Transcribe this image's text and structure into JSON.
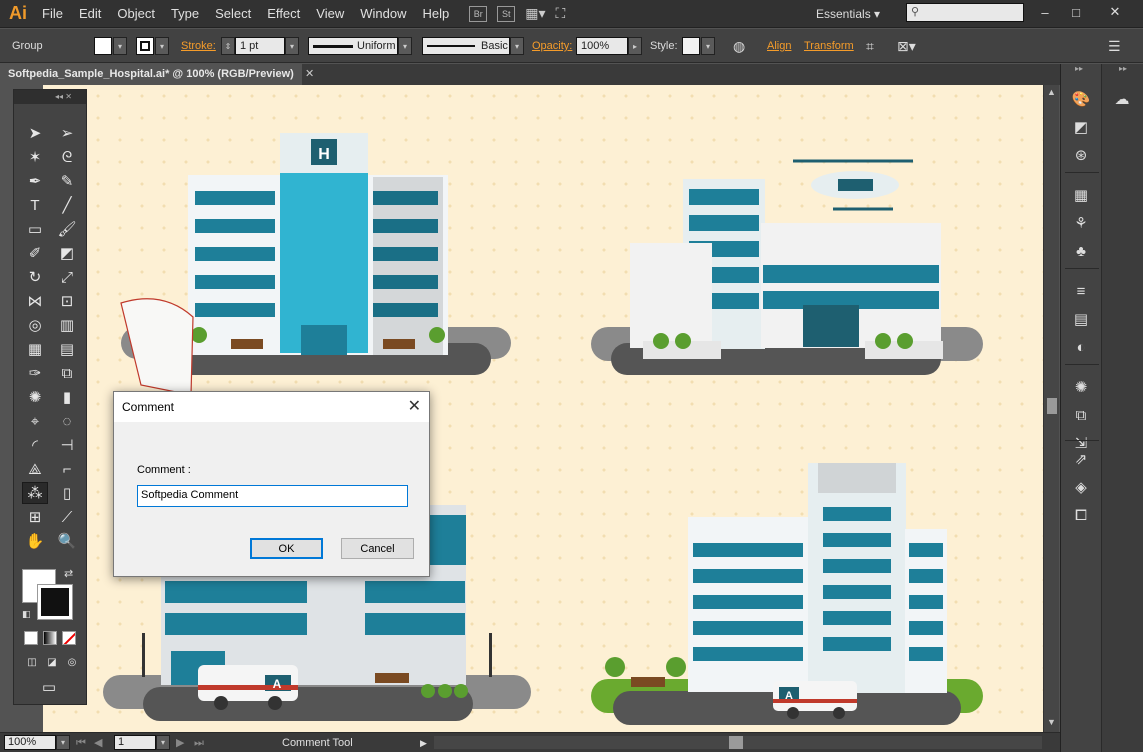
{
  "app": {
    "logo": "Ai",
    "menu": [
      "File",
      "Edit",
      "Object",
      "Type",
      "Select",
      "Effect",
      "View",
      "Window",
      "Help"
    ],
    "bridge_label": "Br",
    "stock_label": "St",
    "workspace": "Essentials",
    "window_buttons": [
      "–",
      "□",
      "✕"
    ]
  },
  "control_bar": {
    "selection_label": "Group",
    "stroke_label": "Stroke:",
    "stroke_weight": "1 pt",
    "profile": "Uniform",
    "brush": "Basic",
    "opacity_label": "Opacity:",
    "opacity_value": "100%",
    "style_label": "Style:",
    "align_label": "Align",
    "transform_label": "Transform"
  },
  "document": {
    "tab_title": "Softpedia_Sample_Hospital.ai* @ 100% (RGB/Preview)",
    "tab_close": "✕"
  },
  "status_bar": {
    "zoom": "100%",
    "artboard": "1",
    "tool_name": "Comment Tool"
  },
  "dialog": {
    "title": "Comment",
    "close_glyph": "✕",
    "field_label": "Comment :",
    "field_value": "Softpedia Comment",
    "ok_label": "OK",
    "cancel_label": "Cancel"
  },
  "artwork": {
    "hospital_sign": "H",
    "ambulance_letter": "A"
  },
  "colors": {
    "accent_orange": "#f59c2a",
    "canvas_bg": "#fdf0d4",
    "building_teal": "#1e7f99",
    "glass_cyan": "#30b4d1"
  }
}
